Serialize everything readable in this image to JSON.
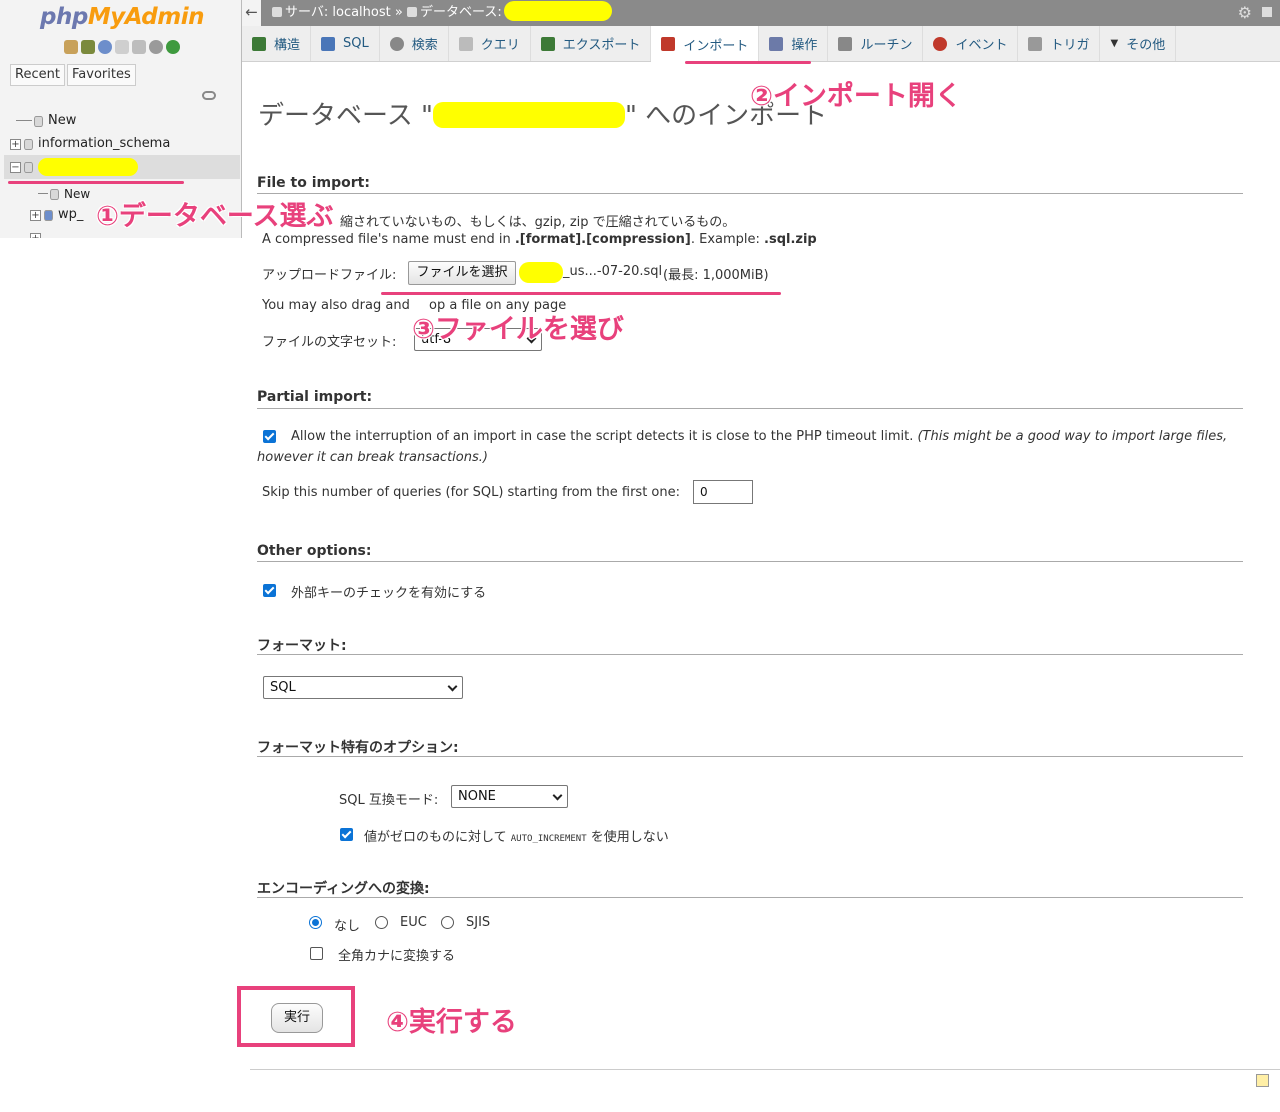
{
  "sidebar": {
    "logo_php": "php",
    "logo_myadmin": "MyAdmin",
    "recent_label": "Recent",
    "favorites_label": "Favorites",
    "tree": {
      "new_label": "New",
      "information_schema": "information_schema",
      "child_new": "New",
      "child_wp": "wp_"
    }
  },
  "topbar": {
    "server_label": "サーバ: localhost",
    "separator": "»",
    "database_label": "データベース:"
  },
  "tabs": [
    {
      "label": "構造",
      "icon": "structure-icon",
      "color": "#3d7a37"
    },
    {
      "label": "SQL",
      "icon": "sql-icon",
      "color": "#4a76b8"
    },
    {
      "label": "検索",
      "icon": "search-icon",
      "color": "#888888"
    },
    {
      "label": "クエリ",
      "icon": "query-icon",
      "color": "#aaaaaa"
    },
    {
      "label": "エクスポート",
      "icon": "export-icon",
      "color": "#3d7a37"
    },
    {
      "label": "インポート",
      "icon": "import-icon",
      "color": "#c0392b"
    },
    {
      "label": "操作",
      "icon": "wrench-icon",
      "color": "#6c7aa8"
    },
    {
      "label": "ルーチン",
      "icon": "routine-icon",
      "color": "#888888"
    },
    {
      "label": "イベント",
      "icon": "clock-icon",
      "color": "#c0392b"
    },
    {
      "label": "トリガ",
      "icon": "trigger-icon",
      "color": "#888888"
    },
    {
      "label": "その他",
      "icon": "chevron-down-icon",
      "color": "#333333"
    }
  ],
  "page": {
    "title_prefix": "データベース \"",
    "title_suffix": "\" へのインポート"
  },
  "file_import": {
    "heading": "File to import:",
    "desc1_partial": "縮されていないもの、もしくは、gzip, zip で圧縮されているもの。",
    "desc2_a": "A compressed file's name must end in ",
    "desc2_b": ".[format].[compression]",
    "desc2_c": ". Example: ",
    "desc2_d": ".sql.zip",
    "upload_label": "アップロードファイル:",
    "choose_file_button": "ファイルを選択",
    "file_name": "_us...-07-20.sql",
    "max_size": "(最長: 1,000MiB)",
    "drag_drop_partial_a": "You may also drag and",
    "drag_drop_partial_b": "op a file on any page",
    "charset_label": "ファイルの文字セット:",
    "charset_value": "utf-8"
  },
  "partial_import": {
    "heading": "Partial import:",
    "interrupt_label": "Allow the interruption of an import in case the script detects it is close to the PHP timeout limit.",
    "interrupt_note_1": "(This might be a good way to import large files,",
    "interrupt_note_2": "however it can break transactions.)",
    "interrupt_checked": true,
    "skip_label": "Skip this number of queries (for SQL) starting from the first one:",
    "skip_value": "0"
  },
  "other_options": {
    "heading": "Other options:",
    "fk_label": "外部キーのチェックを有効にする",
    "fk_checked": true
  },
  "format": {
    "heading": "フォーマット:",
    "value": "SQL"
  },
  "format_options": {
    "heading": "フォーマット特有のオプション:",
    "compat_label": "SQL 互換モード:",
    "compat_value": "NONE",
    "auto_inc_prefix": "値がゼロのものに対して",
    "auto_inc_code": "AUTO_INCREMENT",
    "auto_inc_suffix": "を使用しない",
    "auto_inc_checked": true
  },
  "encoding": {
    "heading": "エンコーディングへの変換:",
    "opt_none": "なし",
    "opt_euc": "EUC",
    "opt_sjis": "SJIS",
    "zenkaku_label": "全角カナに変換する"
  },
  "submit": {
    "label": "実行"
  },
  "annotations": {
    "step1": "①データベース選ぶ",
    "step2": "②インポート開く",
    "step3": "③ファイルを選び",
    "step4": "④実行する",
    "color": "#e8417c"
  }
}
